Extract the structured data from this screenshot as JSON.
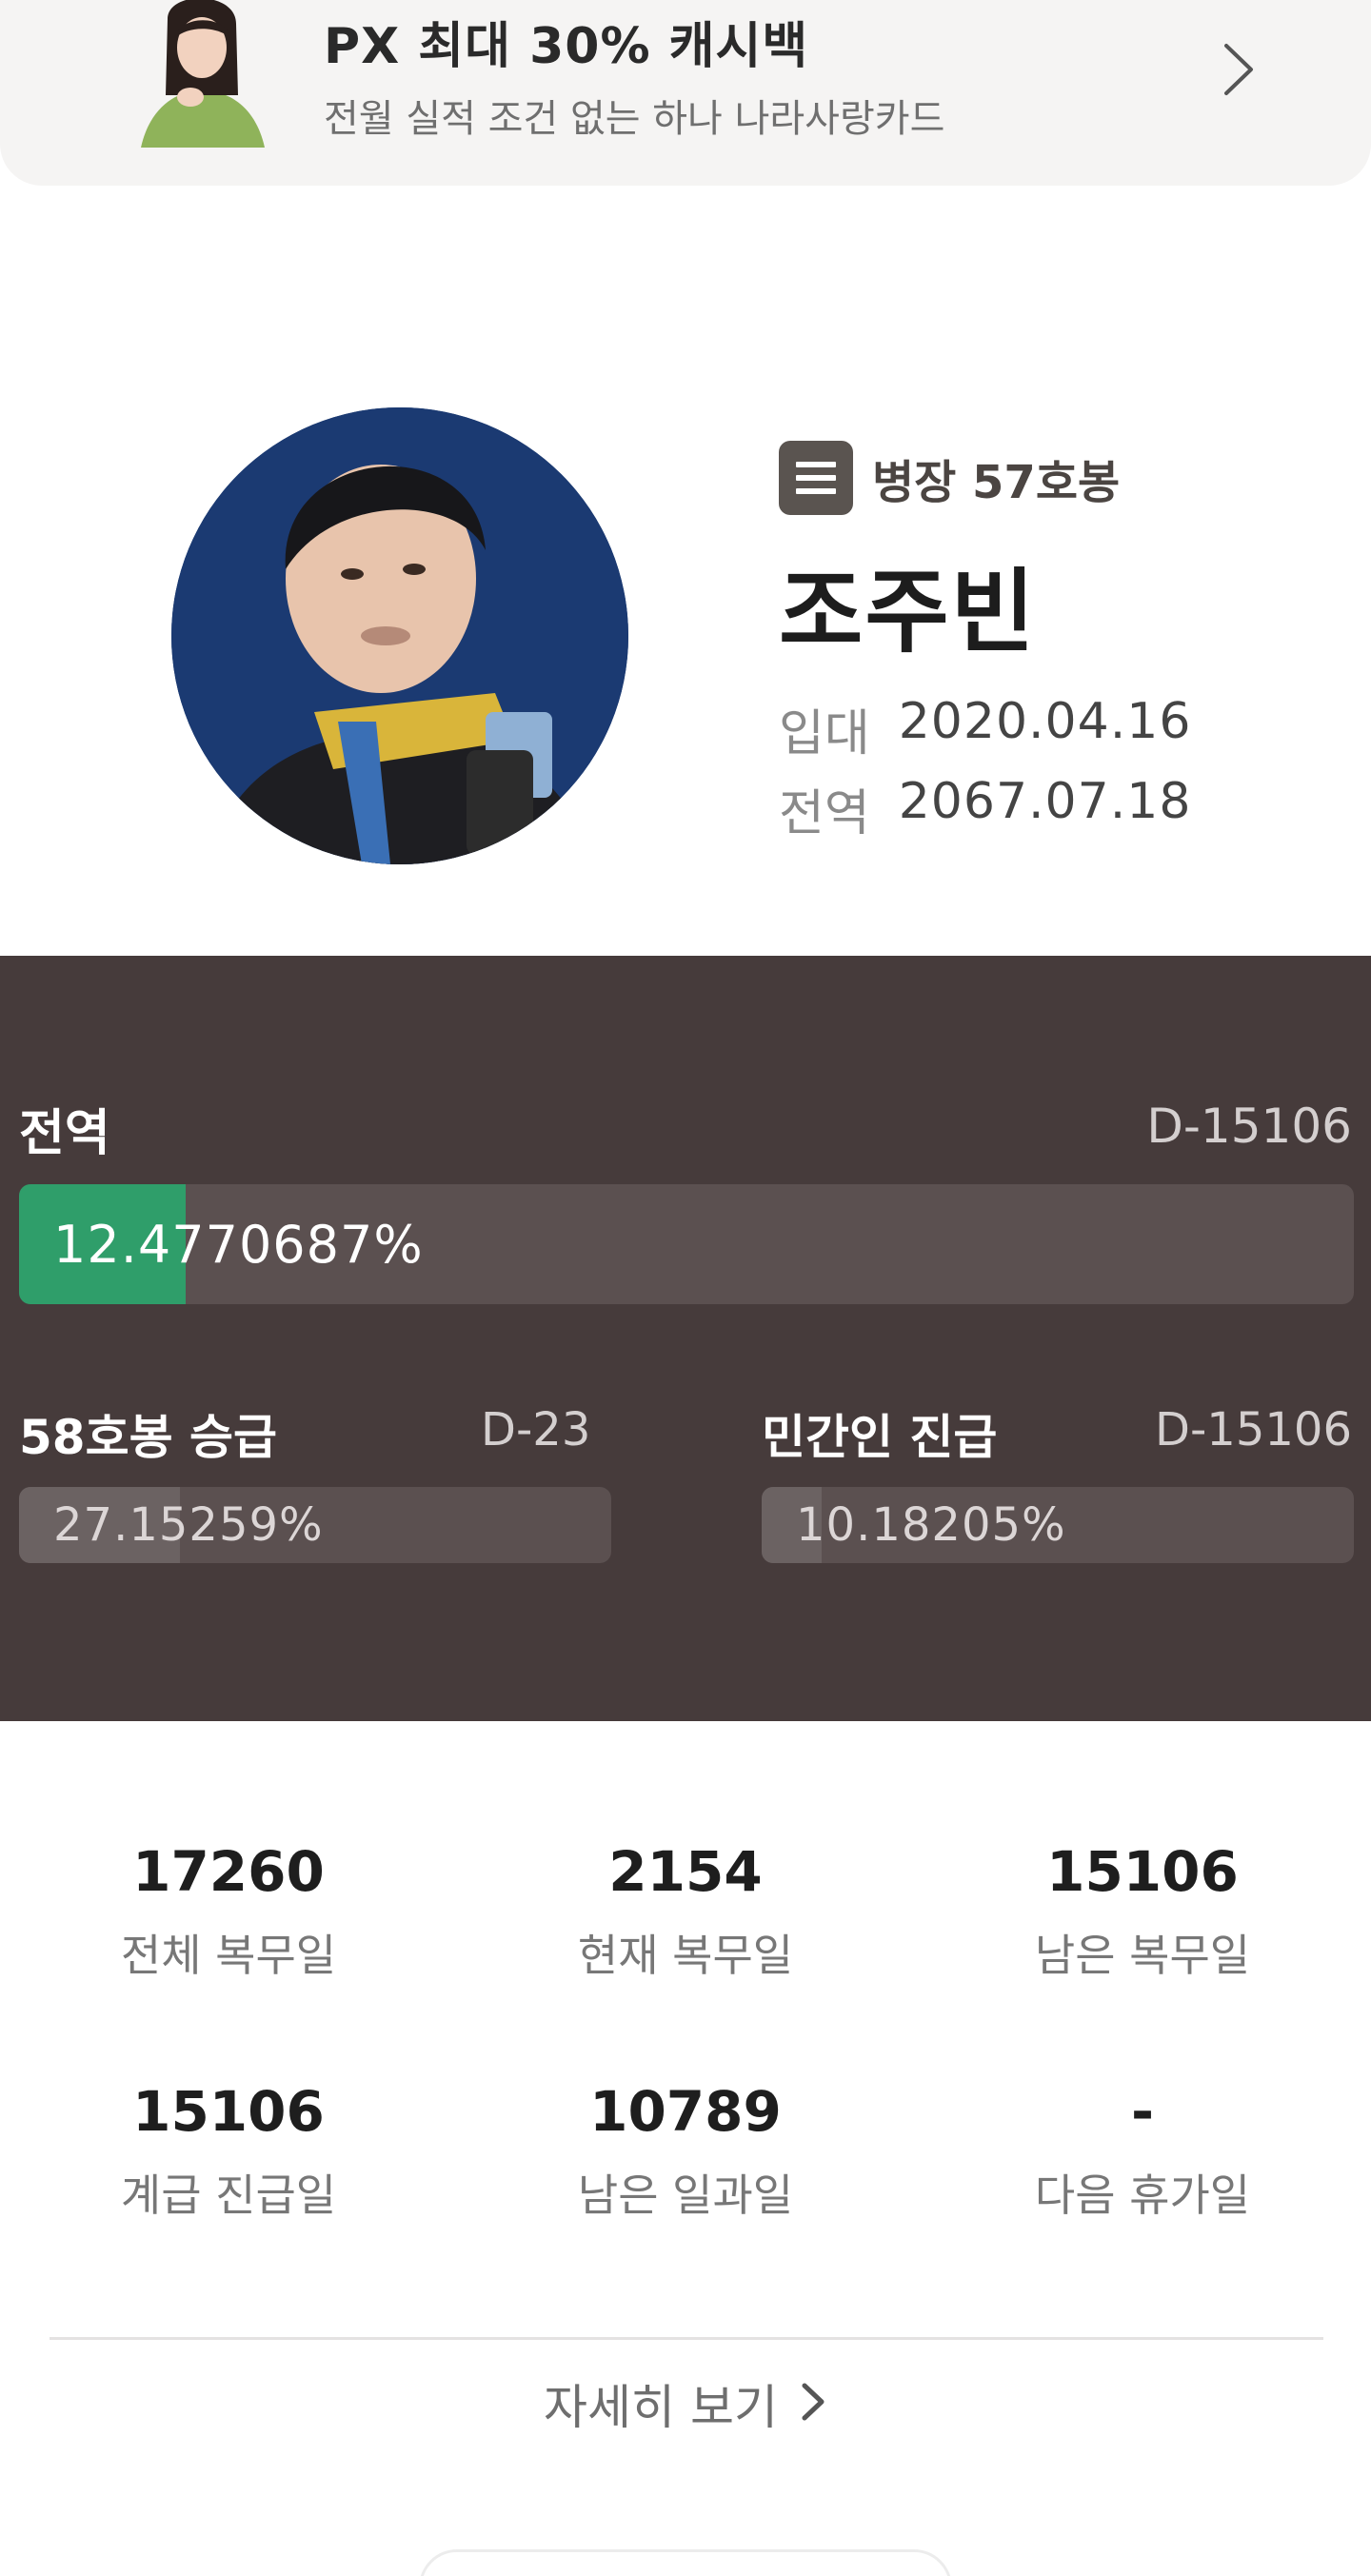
{
  "ad": {
    "title": "PX 최대 30% 캐시백",
    "subtitle": "전월 실적 조건 없는 하나 나라사랑카드"
  },
  "profile": {
    "rank": "병장 57호봉",
    "name": "조주빈",
    "enlist_label": "입대",
    "enlist_date": "2020.04.16",
    "discharge_label": "전역",
    "discharge_date": "2067.07.18"
  },
  "progress": {
    "discharge": {
      "label": "전역",
      "dday": "D-15106",
      "percent_text": "12.4770687%",
      "percent": 12.4770687,
      "fill_color": "#2f9e6a"
    },
    "promotion": {
      "label": "58호봉 승급",
      "dday": "D-23",
      "percent_text": "27.15259%",
      "percent": 27.15259,
      "fill_color": "#6b6262"
    },
    "civilian": {
      "label": "민간인 진급",
      "dday": "D-15106",
      "percent_text": "10.18205%",
      "percent": 10.18205,
      "fill_color": "#6b6262"
    }
  },
  "stats": [
    {
      "value": "17260",
      "label": "전체 복무일"
    },
    {
      "value": "2154",
      "label": "현재 복무일"
    },
    {
      "value": "15106",
      "label": "남은 복무일"
    },
    {
      "value": "15106",
      "label": "계급 진급일"
    },
    {
      "value": "10789",
      "label": "남은 일과일"
    },
    {
      "value": "-",
      "label": "다음 휴가일"
    }
  ],
  "detail_link": "자세히 보기",
  "colors": {
    "panel_bg": "#463b3b",
    "accent_green": "#2f9e6a"
  }
}
